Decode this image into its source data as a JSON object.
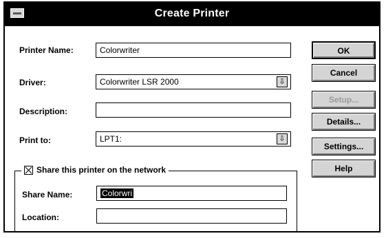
{
  "window": {
    "title": "Create Printer"
  },
  "form": {
    "printer_name_label": "Printer Name:",
    "printer_name_value": "Colorwriter",
    "driver_label": "Driver:",
    "driver_value": "Colorwriter LSR 2000",
    "description_label": "Description:",
    "description_value": "",
    "print_to_label": "Print to:",
    "print_to_value": "LPT1:"
  },
  "share": {
    "checkbox_label": "Share this printer on the network",
    "checked": true,
    "share_name_label": "Share Name:",
    "share_name_value": "Colorwri",
    "location_label": "Location:",
    "location_value": ""
  },
  "buttons": {
    "ok": "OK",
    "cancel": "Cancel",
    "setup": "Setup...",
    "details": "Details...",
    "settings": "Settings...",
    "help": "Help"
  },
  "icons": {
    "system_menu": "system-menu-icon",
    "dropdown": "dropdown-arrow-icon",
    "checkbox": "checkbox-checked-icon"
  }
}
